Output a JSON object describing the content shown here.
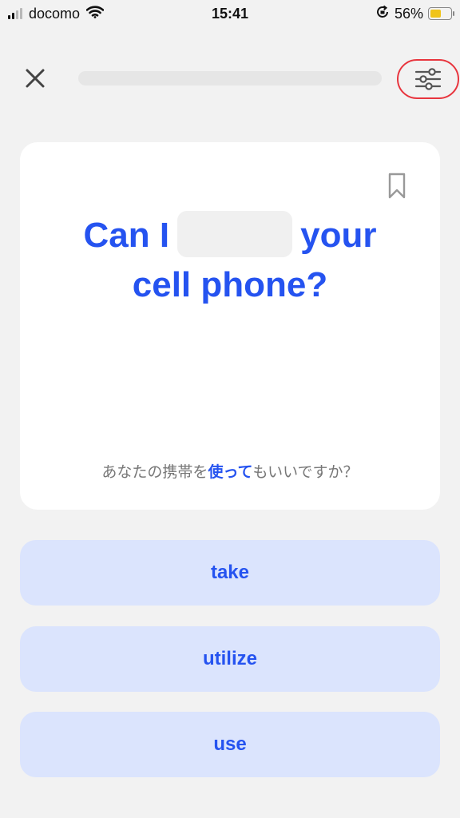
{
  "status_bar": {
    "carrier": "docomo",
    "time": "15:41",
    "battery_percent": "56%",
    "battery_level": 0.56,
    "icons": [
      "signal-icon",
      "wifi-icon",
      "orientation-lock-icon",
      "battery-icon"
    ]
  },
  "header": {
    "close_icon": "close-icon",
    "settings_icon": "sliders-icon",
    "progress": 0,
    "highlight_color": "#e8353e"
  },
  "question": {
    "before_blank": "Can I",
    "after_blank_line1": "your",
    "line2": "cell phone?",
    "translation_before": "あなたの携帯を",
    "translation_highlight": "使って",
    "translation_after": "もいいですか？",
    "bookmark_icon": "bookmark-icon"
  },
  "choices": [
    {
      "label": "take"
    },
    {
      "label": "utilize"
    },
    {
      "label": "use"
    }
  ],
  "colors": {
    "accent": "#2553f0",
    "choice_bg": "#dbe4fd",
    "background": "#f2f2f2",
    "battery": "#f0c419"
  }
}
